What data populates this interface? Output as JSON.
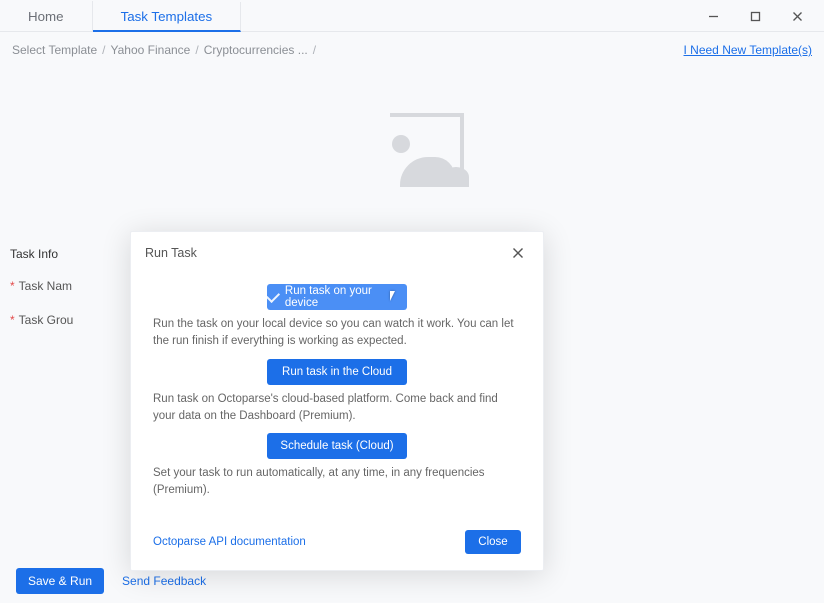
{
  "tabs": {
    "home": "Home",
    "task_templates": "Task Templates"
  },
  "window_controls": {
    "minimize": "–",
    "maximize": "☐",
    "close": "✕"
  },
  "breadcrumbs": {
    "select_template": "Select Template",
    "yahoo": "Yahoo Finance",
    "crypto": "Cryptocurrencies ...",
    "sep": "/",
    "need_link": "I Need New Template(s)"
  },
  "panel": {
    "title": "Task Info",
    "field1": "Task Nam",
    "field2": "Task Grou"
  },
  "modal": {
    "title": "Run Task",
    "run1": {
      "label": "Run task on your device",
      "desc": "Run the task on your local device so you can watch it work. You can let the run finish if everything is working as expected."
    },
    "run2": {
      "label": "Run task in the Cloud",
      "desc": "Run task on Octoparse's cloud-based platform. Come back and find your data on the Dashboard (Premium)."
    },
    "run3": {
      "label": "Schedule task (Cloud)",
      "desc": "Set your task to run automatically, at any time, in any frequencies (Premium)."
    },
    "api_link": "Octoparse API documentation",
    "close": "Close"
  },
  "footer": {
    "save_run": "Save & Run",
    "feedback": "Send Feedback"
  }
}
